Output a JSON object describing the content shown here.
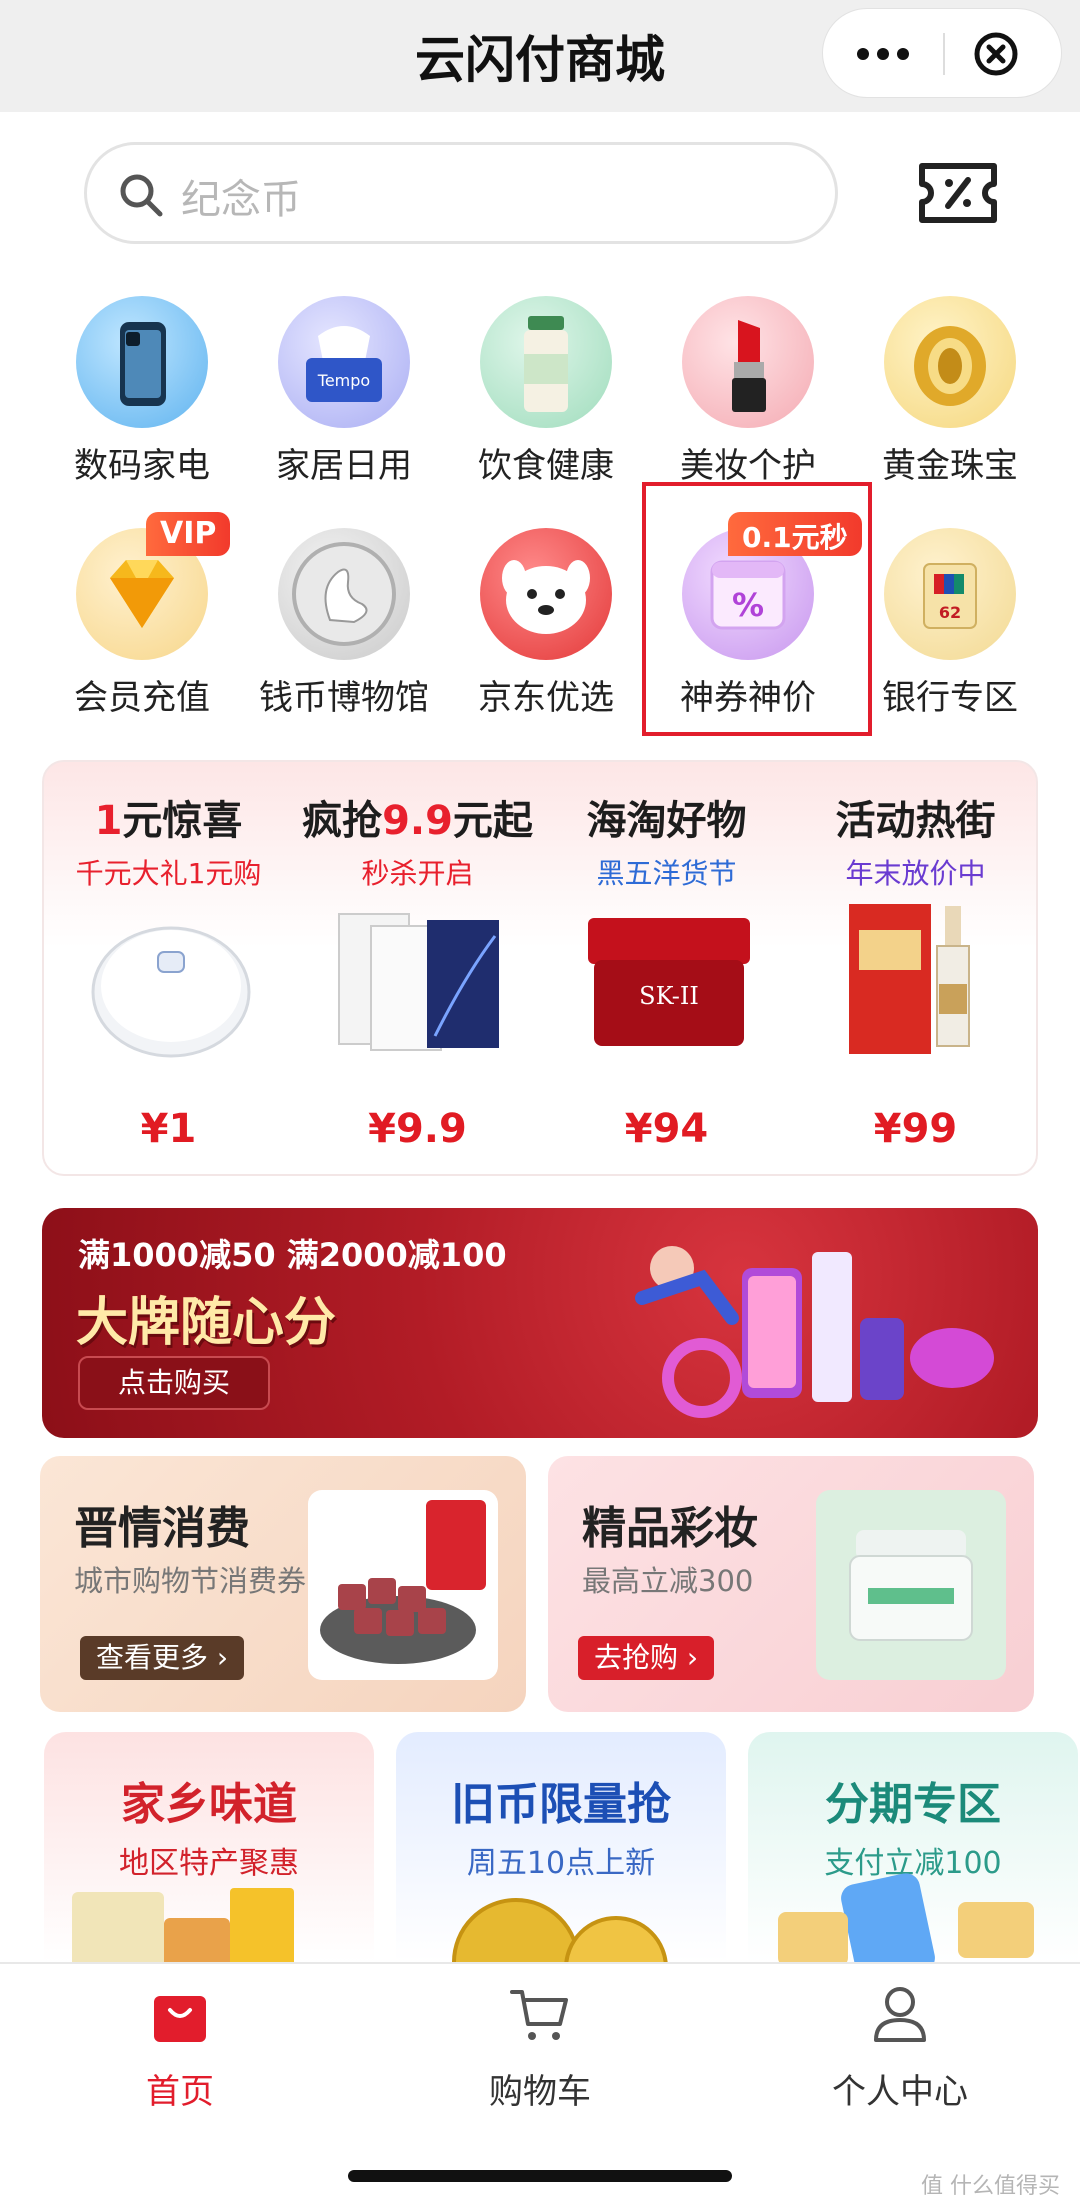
{
  "header": {
    "title": "云闪付商城"
  },
  "search": {
    "placeholder": "纪念币"
  },
  "categories": [
    {
      "label": "数码家电",
      "icon": "phone-icon"
    },
    {
      "label": "家居日用",
      "icon": "tissue-icon"
    },
    {
      "label": "饮食健康",
      "icon": "bottle-icon"
    },
    {
      "label": "美妆个护",
      "icon": "lipstick-icon"
    },
    {
      "label": "黄金珠宝",
      "icon": "gold-ring-icon"
    },
    {
      "label": "会员充值",
      "icon": "diamond-icon",
      "badge": "VIP"
    },
    {
      "label": "钱币博物馆",
      "icon": "swan-coin-icon"
    },
    {
      "label": "京东优选",
      "icon": "jd-dog-icon"
    },
    {
      "label": "神券神价",
      "icon": "coupon-calendar-icon",
      "badge": "0.1元秒"
    },
    {
      "label": "银行专区",
      "icon": "bank-card-icon"
    }
  ],
  "promos": [
    {
      "title_hl": "1",
      "title": "元惊喜",
      "subtitle": "千元大礼1元购",
      "price": "¥1",
      "subtitle_color": "#e8202d"
    },
    {
      "title": "疯抢",
      "title_hl": "9.9",
      "title_end": "元起",
      "subtitle": "秒杀开启",
      "price": "¥9.9",
      "subtitle_color": "#e8202d"
    },
    {
      "title": "海淘好物",
      "subtitle": "黑五洋货节",
      "price": "¥94",
      "subtitle_color": "#2e6bd6"
    },
    {
      "title": "活动热街",
      "subtitle": "年末放价中",
      "price": "¥99",
      "subtitle_color": "#6a3bd1"
    }
  ],
  "banner": {
    "line1": "满1000减50 满2000减100",
    "line2": "大牌随心分",
    "button": "点击购买"
  },
  "cards": [
    {
      "title": "晋情消费",
      "desc": "城市购物节消费券",
      "button": "查看更多 ›"
    },
    {
      "title": "精品彩妆",
      "desc": "最高立减300",
      "button": "去抢购 ›"
    }
  ],
  "minis": [
    {
      "title": "家乡味道",
      "desc": "地区特产聚惠",
      "title_color": "#d2222b",
      "desc_color": "#d2222b"
    },
    {
      "title": "旧币限量抢",
      "desc": "周五10点上新",
      "title_color": "#1c4fb5",
      "desc_color": "#3968c4"
    },
    {
      "title": "分期专区",
      "desc": "支付立减100",
      "title_color": "#1b8a7a",
      "desc_color": "#2c9b8a"
    }
  ],
  "tabs": [
    {
      "label": "首页",
      "icon": "shopping-bag-icon"
    },
    {
      "label": "购物车",
      "icon": "cart-icon"
    },
    {
      "label": "个人中心",
      "icon": "user-icon"
    }
  ],
  "watermark": "值 什么值得买"
}
